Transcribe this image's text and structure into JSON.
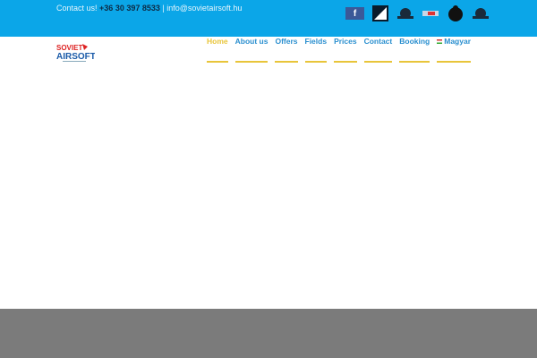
{
  "topbar": {
    "contact_label": "Contact us!",
    "phone": "+36 30 397 8533",
    "separator": "|",
    "email": "info@sovietairsoft.hu",
    "social_icons": [
      "facebook-icon",
      "partner-logo-1",
      "partner-logo-2",
      "partner-logo-3",
      "partner-logo-4",
      "partner-logo-5"
    ]
  },
  "logo": {
    "text": "SOVIET AIRSOFT"
  },
  "nav": {
    "items": [
      {
        "label": "Home"
      },
      {
        "label": "About us"
      },
      {
        "label": "Offers"
      },
      {
        "label": "Fields"
      },
      {
        "label": "Prices"
      },
      {
        "label": "Contact"
      },
      {
        "label": "Booking"
      },
      {
        "label": "Magyar"
      }
    ]
  },
  "colors": {
    "topbar": "#0ba6e8",
    "nav_text": "#2a8fcf",
    "active": "#e8c53a",
    "footer": "#7b7b7b"
  }
}
